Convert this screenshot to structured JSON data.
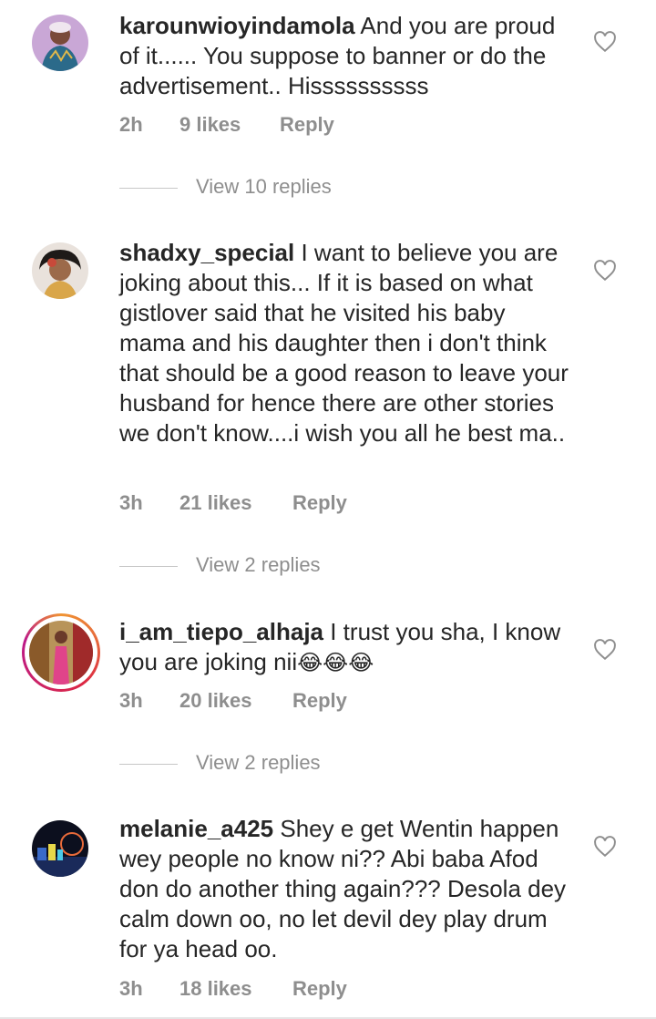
{
  "comments": [
    {
      "username": "karounwioyindamola",
      "text": "And you are proud of it...... You suppose to banner or do the advertisement.. Hissssssssss",
      "time": "2h",
      "likes": "9 likes",
      "reply_label": "Reply",
      "view_replies": "View 10 replies",
      "avatar_icon": "profile-photo"
    },
    {
      "username": "shadxy_special",
      "text": "I want to believe you are joking about this... If it is based on what gistlover said that he visited his baby mama and his daughter then i don't think that should be a good reason to leave your husband for hence there are other stories we don't know....i wish you all he best ma..",
      "time": "3h",
      "likes": "21 likes",
      "reply_label": "Reply",
      "view_replies": "View 2 replies",
      "avatar_icon": "profile-photo"
    },
    {
      "username": "i_am_tiepo_alhaja",
      "text": "I trust you sha, I know you are joking nii",
      "emoji": "😂😂😂",
      "time": "3h",
      "likes": "20 likes",
      "reply_label": "Reply",
      "view_replies": "View 2 replies",
      "avatar_icon": "profile-photo-with-story-ring"
    },
    {
      "username": "melanie_a425",
      "text": "Shey e get Wentin happen wey people no know ni?? Abi baba Afod don do another thing again??? Desola dey calm down oo, no let devil dey play drum for ya head oo.",
      "time": "3h",
      "likes": "18 likes",
      "reply_label": "Reply",
      "avatar_icon": "profile-photo"
    }
  ],
  "colors": {
    "text": "#262626",
    "muted": "#8e8e8e",
    "divider": "#c7c7c7"
  },
  "icons": {
    "like": "heart-outline-icon"
  }
}
